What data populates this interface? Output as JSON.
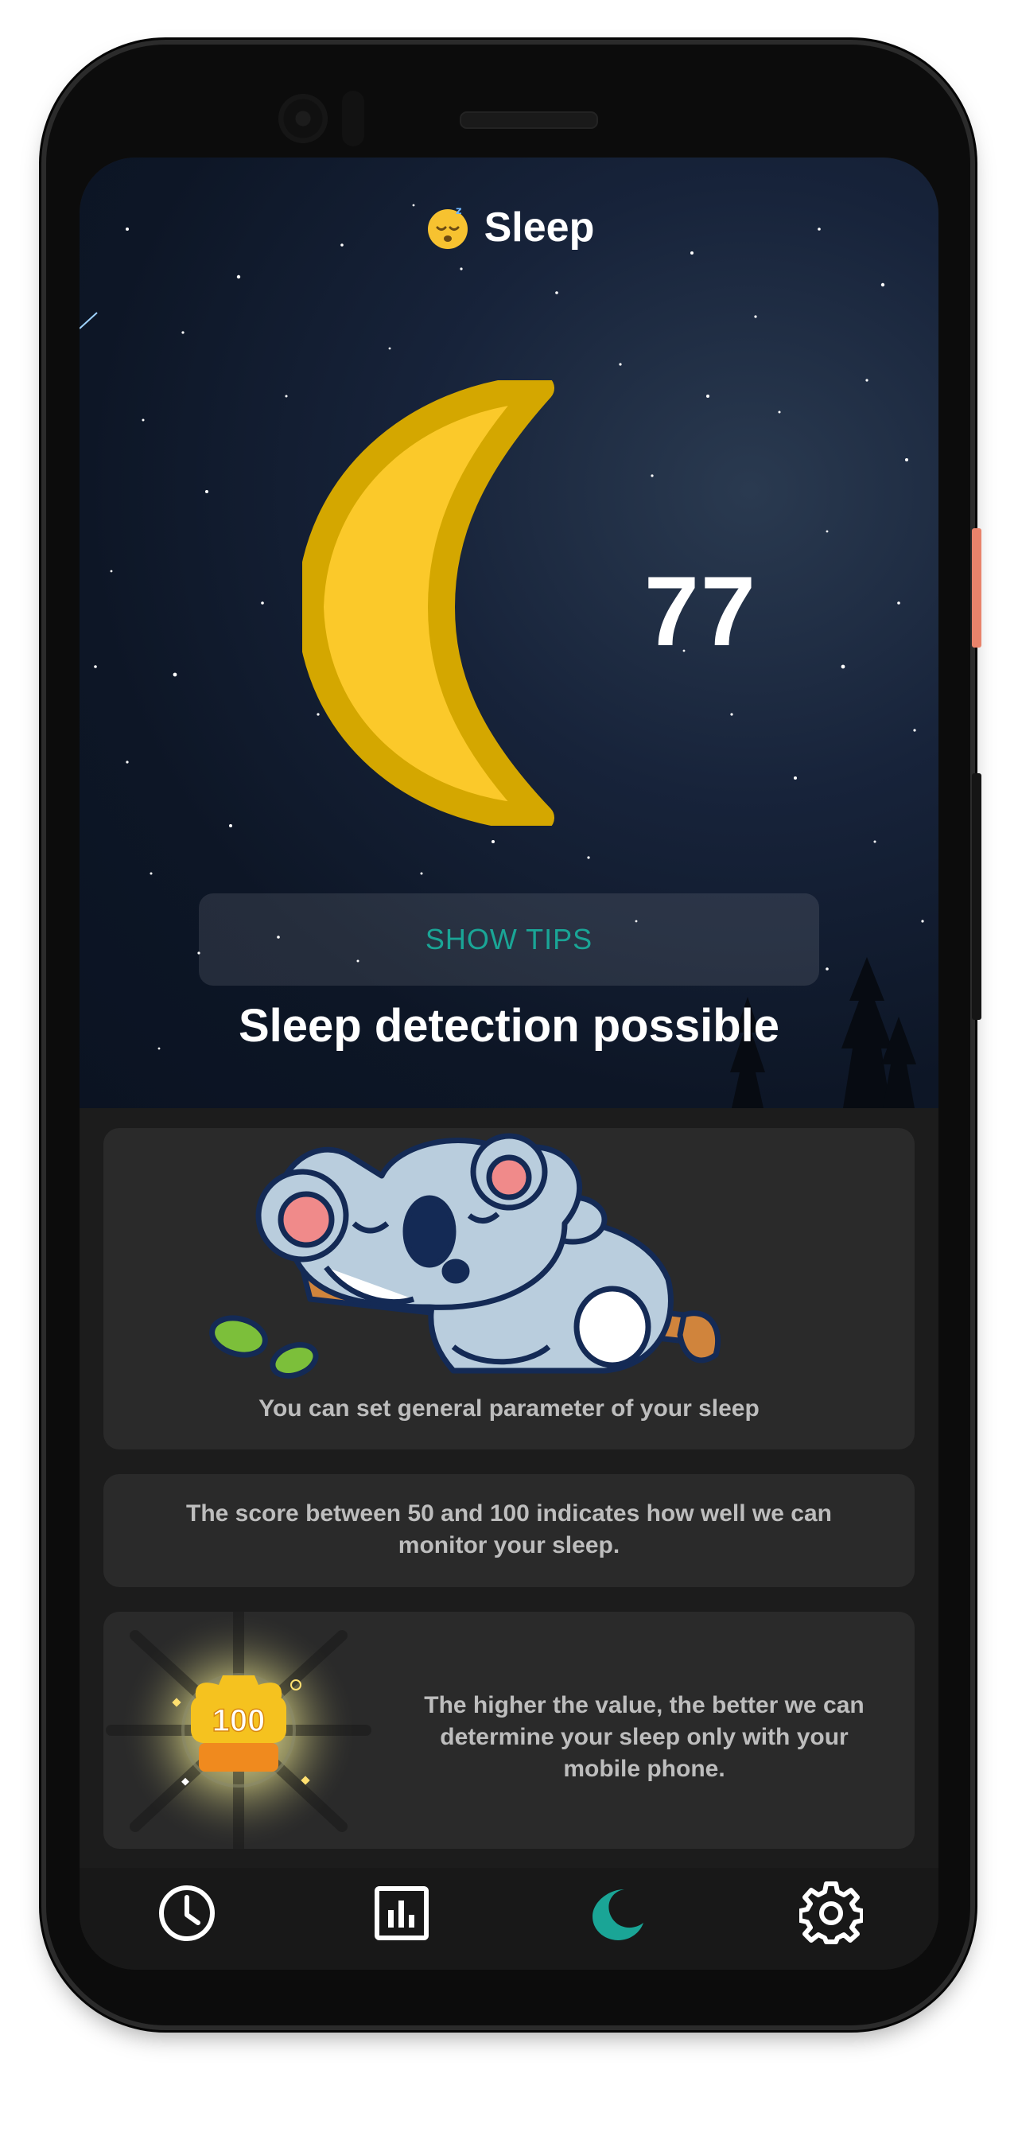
{
  "header": {
    "emoji_icon": "sleeping-face-icon",
    "title": "Sleep"
  },
  "hero": {
    "score": "77",
    "tips_button_label": "SHOW TIPS",
    "status_text": "Sleep detection possible"
  },
  "cards": {
    "params_text": "You can set general parameter of your sleep",
    "score_info_text": "The score between 50 and 100 indicates how well we can monitor your sleep.",
    "badge_value": "100",
    "higher_value_text": "The higher the value, the better we can determine your sleep only with your mobile phone."
  },
  "nav": {
    "items": [
      {
        "icon": "clock-icon",
        "active": false
      },
      {
        "icon": "chart-icon",
        "active": false
      },
      {
        "icon": "moon-icon",
        "active": true
      },
      {
        "icon": "gear-icon",
        "active": false
      }
    ]
  },
  "colors": {
    "accent": "#1aa596",
    "moon_fill": "#fbc92a",
    "moon_outline": "#d4a700",
    "card_bg": "#2a2a2a",
    "screen_bg": "#1c1c1c"
  }
}
